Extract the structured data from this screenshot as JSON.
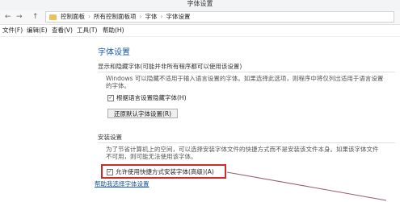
{
  "window": {
    "title": "字体设置"
  },
  "address": {
    "back": "←",
    "forward": "→",
    "up": "↑",
    "breadcrumbs": [
      "控制面板",
      "所有控制面板项",
      "字体",
      "字体设置"
    ]
  },
  "menu": {
    "items": [
      "文件(F)",
      "编辑(E)",
      "查看(V)",
      "工具(T)",
      "帮助(H)"
    ]
  },
  "main": {
    "title": "字体设置",
    "hide_section": {
      "title": "显示和隐藏字体(可能并非所有程序都可以使用该设置)",
      "description_line1": "Windows 可以隐藏不适用于输入语言设置的字体。如果选择此选项，则程序中将仅列出适用于语言设置",
      "description_line2": "的字体。",
      "checkbox_label": "根据语言设置隐藏字体(H)",
      "checkbox_checked": true,
      "restore_button": "还原默认字体设置(R)"
    },
    "install_section": {
      "title": "安装设置",
      "description_line1": "为了节省计算机上的空间，可以选择安装字体文件的快捷方式而不是安装该文件本身。如果该字体文件",
      "description_line2": "不可用，则可能无法使用该字体。",
      "checkbox_label": "允许使用快捷方式安装字体(高级)(A)",
      "checkbox_checked": true
    },
    "help_link": "帮助我选择字体设置"
  },
  "colors": {
    "accent": "#1a5aa8",
    "highlight_border": "#d02a2a"
  }
}
